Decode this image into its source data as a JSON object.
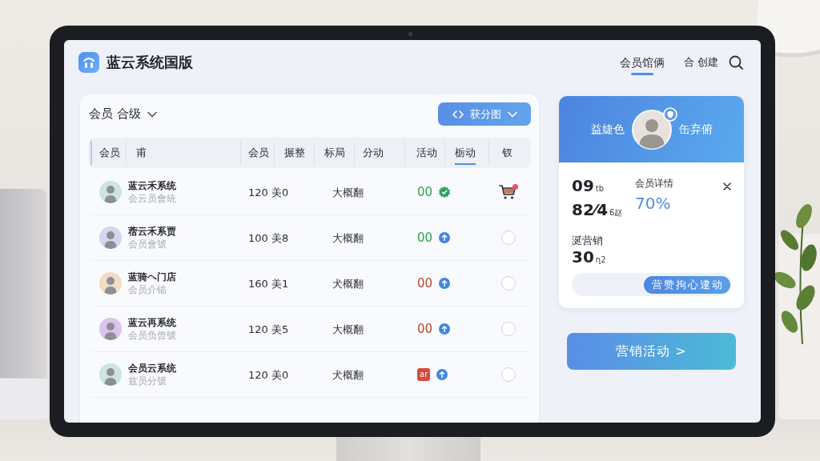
{
  "app": {
    "title": "蓝云系统国版"
  },
  "nav_tabs": [
    {
      "label": "会员馆俩",
      "selected": true
    }
  ],
  "create_button": {
    "label": "合 创建"
  },
  "member_panel": {
    "title": "会员 合级",
    "view_button": {
      "label": "获分图"
    },
    "columns": [
      {
        "label": "会员",
        "selected": false
      },
      {
        "label": "甫",
        "selected": false
      },
      {
        "label": "会员",
        "selected": false
      },
      {
        "label": "搌整",
        "selected": false
      },
      {
        "label": "标局",
        "selected": false
      },
      {
        "label": "分动",
        "selected": false
      },
      {
        "label": "活动",
        "selected": false
      },
      {
        "label": "栃动",
        "selected": true
      },
      {
        "label": "钗",
        "selected": false
      }
    ],
    "rows": [
      {
        "avatar": {
          "color": "#cfe4e1"
        },
        "name": "蓝云禾系统",
        "subtitle": "会云员會統",
        "value": "120 美0",
        "tag": "大概翻",
        "status": {
          "kind": "text",
          "text": "00",
          "color": "#2ea34f"
        },
        "indicator": {
          "kind": "seal"
        },
        "action": {
          "kind": "cart"
        }
      },
      {
        "avatar": {
          "color": "#d6d4f0"
        },
        "name": "蓿云禾系贾",
        "subtitle": "会员會號",
        "value": "100 美8",
        "tag": "大概翻",
        "status": {
          "kind": "text",
          "text": "00",
          "color": "#2ea34f"
        },
        "indicator": {
          "kind": "arrow"
        },
        "action": {
          "kind": "radio",
          "checked": false
        }
      },
      {
        "avatar": {
          "color": "#f1dcc4"
        },
        "name": "蓝骑ヘ门店",
        "subtitle": "会员介锸",
        "value": "160 美1",
        "tag": "犬概翻",
        "status": {
          "kind": "text",
          "text": "00",
          "color": "#b5472f"
        },
        "indicator": {
          "kind": "arrow"
        },
        "action": {
          "kind": "radio",
          "checked": false
        }
      },
      {
        "avatar": {
          "color": "#dcc2ec"
        },
        "name": "蓝云再系统",
        "subtitle": "会员负曾號",
        "value": "120 美5",
        "tag": "大概翻",
        "status": {
          "kind": "text",
          "text": "00",
          "color": "#b5472f"
        },
        "indicator": {
          "kind": "arrow"
        },
        "action": {
          "kind": "radio",
          "checked": false
        }
      },
      {
        "avatar": {
          "color": "#cde4df"
        },
        "name": "会员云系统",
        "subtitle": "兹员分號",
        "value": "120 美0",
        "tag": "犬概翻",
        "status": {
          "kind": "badge",
          "text": "ar",
          "color": "#d9493c"
        },
        "indicator": {
          "kind": "arrow"
        },
        "action": {
          "kind": "radio",
          "checked": false
        }
      }
    ]
  },
  "profile_card": {
    "left_label": "益婕色",
    "right_label": "缶弃俯",
    "stats": [
      {
        "value": "09",
        "unit": "tb"
      },
      {
        "value": "82⁄4",
        "unit": "6赵"
      },
      {
        "label": "涎营销",
        "value": "30",
        "unit": "ղ2"
      }
    ],
    "detail": {
      "label": "会员详情",
      "value": "70%"
    },
    "segment": {
      "label": "营赞拘心逮动"
    }
  },
  "cta_button": {
    "label": "营销活动 >"
  }
}
